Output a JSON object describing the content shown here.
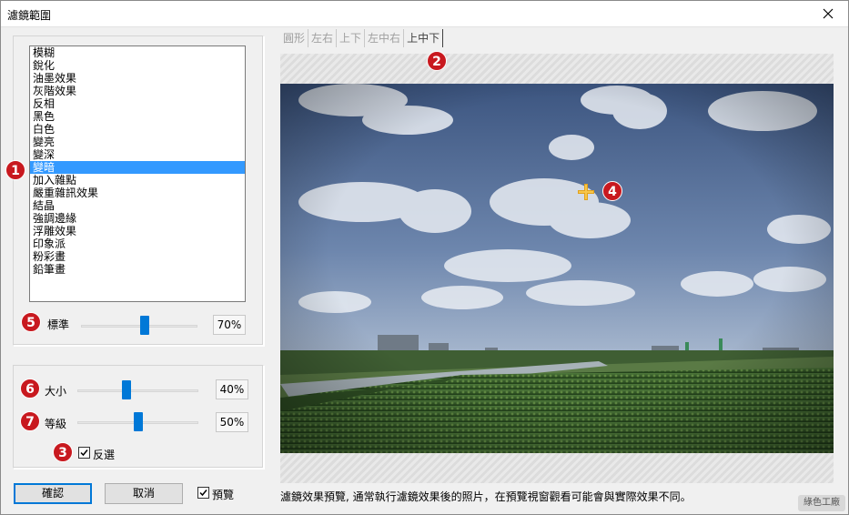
{
  "window": {
    "title": "濾鏡範圍"
  },
  "filters": {
    "items": [
      "模糊",
      "銳化",
      "油墨效果",
      "灰階效果",
      "反相",
      "黑色",
      "白色",
      "變亮",
      "變深",
      "變暗",
      "加入雜點",
      "嚴重雜訊效果",
      "結晶",
      "強調邊緣",
      "浮雕效果",
      "印象派",
      "粉彩畫",
      "鉛筆畫"
    ],
    "selected_index": 9
  },
  "standard": {
    "label": "標準",
    "value": "70%",
    "level": 0.55
  },
  "size": {
    "label": "大小",
    "value": "40%",
    "level": 0.4
  },
  "level": {
    "label": "等級",
    "value": "50%",
    "level": 0.5
  },
  "invert": {
    "label": "反選",
    "checked": true
  },
  "buttons": {
    "ok": "確認",
    "cancel": "取消"
  },
  "preview_toggle": {
    "label": "預覽",
    "checked": true
  },
  "tabs": [
    {
      "label": "圓形",
      "active": false
    },
    {
      "label": "左右",
      "active": false
    },
    {
      "label": "上下",
      "active": false
    },
    {
      "label": "左中右",
      "active": false
    },
    {
      "label": "上中下",
      "active": true
    }
  ],
  "caption": "濾鏡效果預覽, 通常執行濾鏡效果後的照片，在預覽視窗觀看可能會與實際效果不同。",
  "watermark": "綠色工廠",
  "badges": [
    "1",
    "2",
    "3",
    "4",
    "5",
    "6",
    "7"
  ],
  "icons": {
    "close": "close-icon",
    "crosshair": "move-crosshair-icon",
    "check": "checkmark-icon"
  },
  "colors": {
    "accent": "#0078d7",
    "selection": "#3399ff",
    "badge": "#c8191f"
  }
}
